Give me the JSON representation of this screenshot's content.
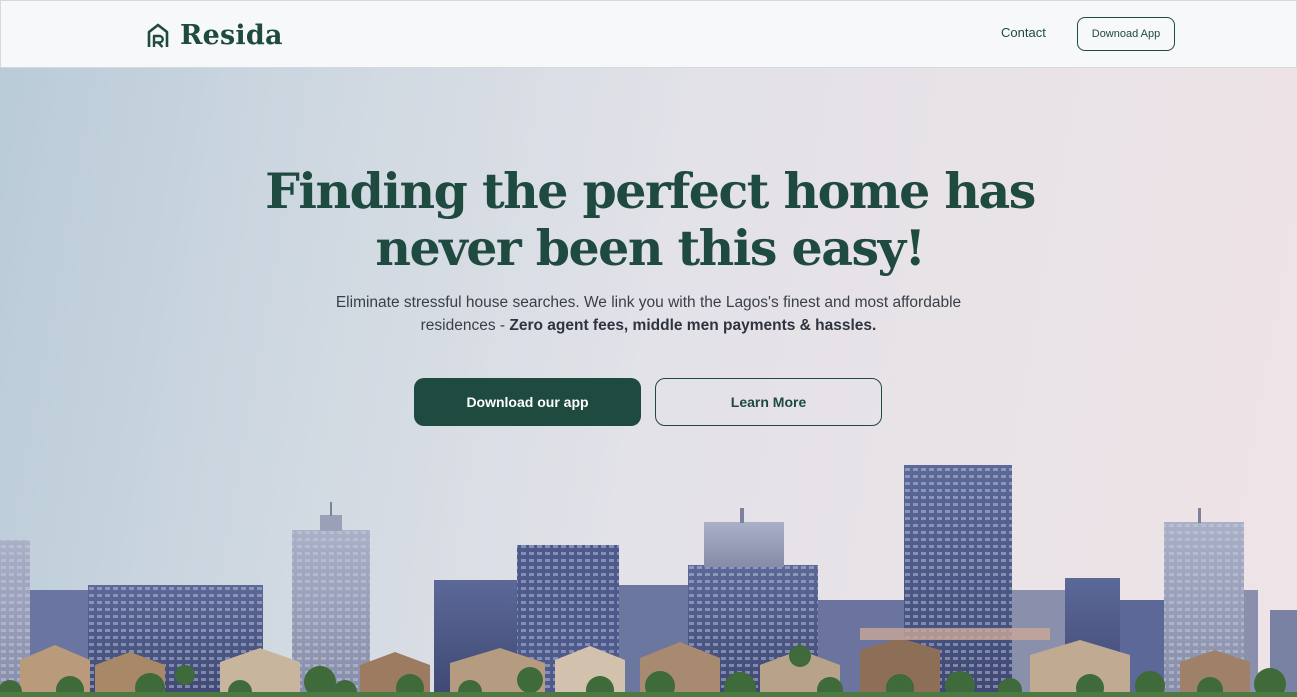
{
  "brand": {
    "name": "Resida",
    "logo_icon": "house-r-logo-icon",
    "color": "#1f4a40"
  },
  "nav": {
    "contact_label": "Contact",
    "download_label": "Downoad App"
  },
  "hero": {
    "title_line1": "Finding the perfect home has",
    "title_line2": "never been this easy!",
    "subtitle_plain": "Eliminate stressful house searches. We link you with the Lagos's finest and most affordable residences - ",
    "subtitle_bold": "Zero agent fees, middle men payments & hassles.",
    "primary_button": "Download our app",
    "secondary_button": "Learn More"
  },
  "colors": {
    "accent": "#1f4a40",
    "text": "#3a3f47"
  }
}
